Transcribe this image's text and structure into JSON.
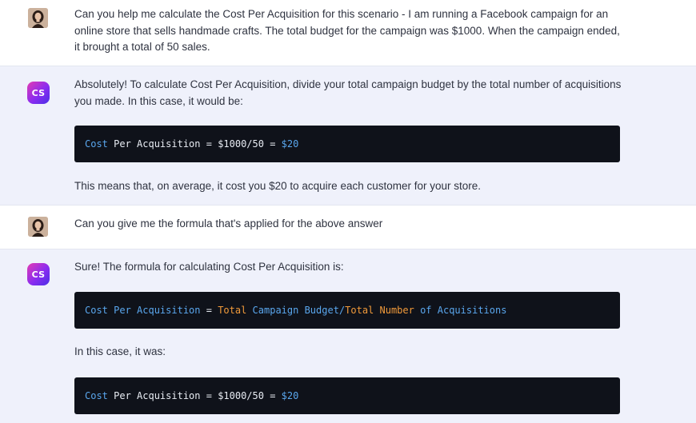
{
  "messages": [
    {
      "role": "user",
      "text": "Can you help me calculate the Cost Per Acquisition for this scenario - I am running a Facebook campaign for an online store that sells handmade crafts. The total budget for the campaign was $1000. When the campaign ended, it brought a total of 50 sales."
    },
    {
      "role": "assistant",
      "avatar_label": "CS",
      "intro": "Absolutely! To calculate Cost Per Acquisition, divide your total campaign budget by the total number of acquisitions you made. In this case, it would be:",
      "code": {
        "w1": "Cost",
        "w2": " Per Acquisition = ",
        "w3": "$1000/50",
        "w4": " = ",
        "w5": "$20"
      },
      "outro": "This means that, on average, it cost you $20 to acquire each customer for your store."
    },
    {
      "role": "user",
      "text": "Can you give me the formula that's applied for the above answer"
    },
    {
      "role": "assistant",
      "avatar_label": "CS",
      "intro": "Sure! The formula for calculating Cost Per Acquisition is:",
      "formula": {
        "w1": "Cost",
        "w2": " Per ",
        "w3": "Acquisition",
        "w4": " = ",
        "w5": "Total",
        "w6": " Campaign Budget/",
        "w7": "Total",
        "w8": " Number ",
        "w9": "of",
        "w10": " Acquisitions"
      },
      "middle": "In this case, it was:",
      "code": {
        "w1": "Cost",
        "w2": " Per Acquisition = ",
        "w3": "$1000/50",
        "w4": " = ",
        "w5": "$20"
      }
    }
  ],
  "colors": {
    "assistant_bg": "#eff1fb",
    "code_bg": "#0f121a",
    "code_keyword": "#5aa7ee",
    "code_highlight": "#f19a3a",
    "avatar_gradient_start": "#e33bb3",
    "avatar_gradient_end": "#4b2fe6"
  }
}
